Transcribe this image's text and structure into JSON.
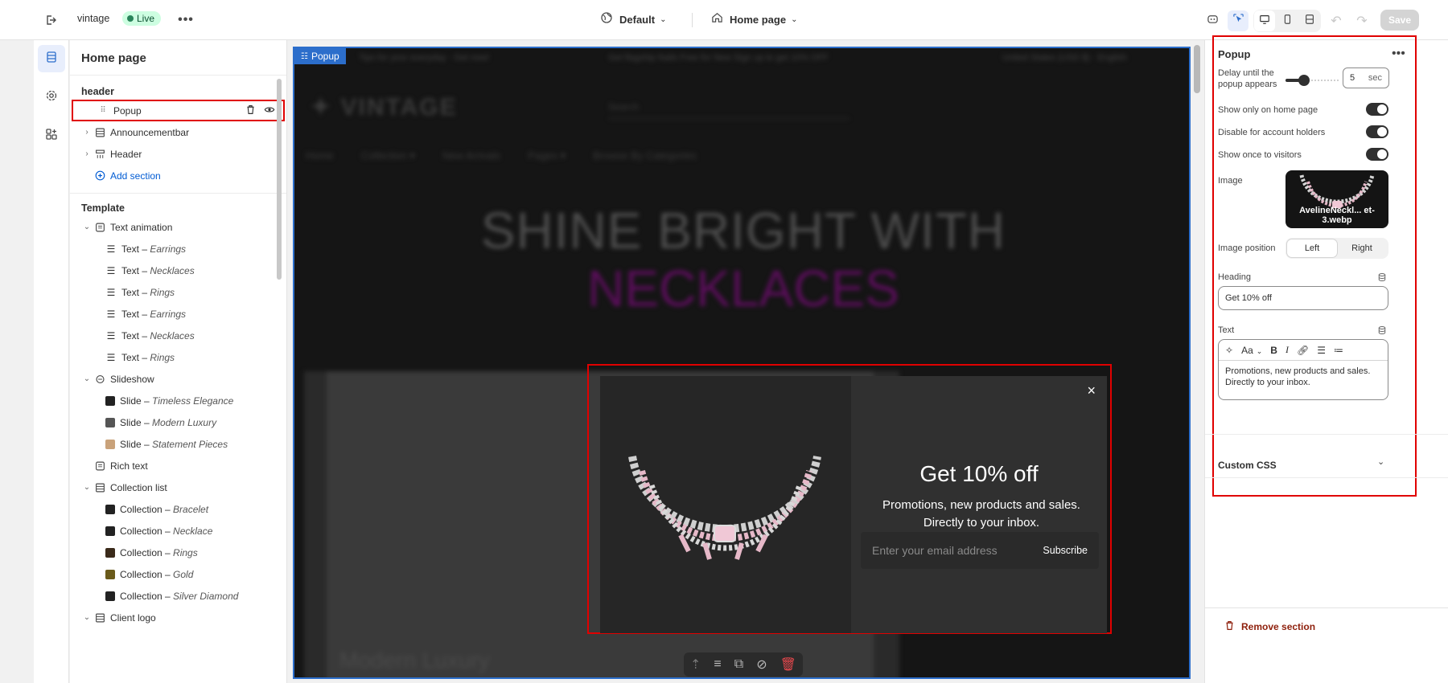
{
  "topbar": {
    "store_name": "vintage",
    "status": "Live",
    "theme": "Default",
    "page": "Home page",
    "save_label": "Save"
  },
  "left_panel": {
    "title": "Home page",
    "header_group": "header",
    "header_items": [
      {
        "label": "Popup",
        "icon": "drag-handle-icon",
        "selected": true
      },
      {
        "label": "Announcementbar",
        "icon": "section-icon"
      },
      {
        "label": "Header",
        "icon": "header-icon"
      }
    ],
    "add_section": "Add section",
    "template_group": "Template",
    "text_animation": "Text animation",
    "text_items": [
      {
        "prefix": "Text –",
        "name": "Earrings"
      },
      {
        "prefix": "Text –",
        "name": "Necklaces"
      },
      {
        "prefix": "Text –",
        "name": "Rings"
      },
      {
        "prefix": "Text –",
        "name": "Earrings"
      },
      {
        "prefix": "Text –",
        "name": "Necklaces"
      },
      {
        "prefix": "Text –",
        "name": "Rings"
      }
    ],
    "slideshow": "Slideshow",
    "slides": [
      {
        "prefix": "Slide –",
        "name": "Timeless Elegance"
      },
      {
        "prefix": "Slide –",
        "name": "Modern Luxury"
      },
      {
        "prefix": "Slide –",
        "name": "Statement Pieces"
      }
    ],
    "rich_text": "Rich text",
    "collection_list": "Collection list",
    "collections": [
      {
        "prefix": "Collection –",
        "name": "Bracelet"
      },
      {
        "prefix": "Collection –",
        "name": "Necklace"
      },
      {
        "prefix": "Collection –",
        "name": "Rings"
      },
      {
        "prefix": "Collection –",
        "name": "Gold"
      },
      {
        "prefix": "Collection –",
        "name": "Silver Diamond"
      }
    ],
    "client_logo": "Client logo"
  },
  "preview": {
    "section_tag": "Popup",
    "announcement_left": "Tips for your everyday · Get now!",
    "announcement_center": "Get flagship Nails Free for New Sign up to get 10% OFF",
    "announcement_right": "United States (USD $) · English",
    "logo": "✦ VINTAGE",
    "search_placeholder": "Search",
    "nav": [
      "Home",
      "Collection ▾",
      "New Arrivals",
      "Pages ▾",
      "Browse By Categories"
    ],
    "hero_line1": "SHINE BRIGHT WITH",
    "hero_line2": "NECKLACES",
    "slide_caption": "Modern Luxury",
    "popup": {
      "close": "×",
      "heading": "Get 10% off",
      "text": "Promotions, new products and sales. Directly to your inbox.",
      "email_placeholder": "Enter your email address",
      "subscribe": "Subscribe"
    }
  },
  "right_panel": {
    "title": "Popup",
    "delay_label": "Delay until the popup appears",
    "delay_value": "5",
    "delay_unit": "sec",
    "delay_fraction": 0.35,
    "toggles": [
      {
        "label": "Show only on home page",
        "on": true
      },
      {
        "label": "Disable for account holders",
        "on": true
      },
      {
        "label": "Show once to visitors",
        "on": true
      }
    ],
    "image_label": "Image",
    "image_filename": "AvelineNeckl... et-3.webp",
    "image_position_label": "Image position",
    "image_position_options": [
      "Left",
      "Right"
    ],
    "heading_label": "Heading",
    "heading_value": "Get 10% off",
    "text_label": "Text",
    "text_font_label": "Aa",
    "text_value": "Promotions, new products and sales. Directly to your inbox.",
    "custom_css": "Custom CSS",
    "remove_section": "Remove section"
  },
  "colors": {
    "accent_blue": "#2c6ecb",
    "annotation_red": "#e00000",
    "live_green": "#29845a"
  }
}
